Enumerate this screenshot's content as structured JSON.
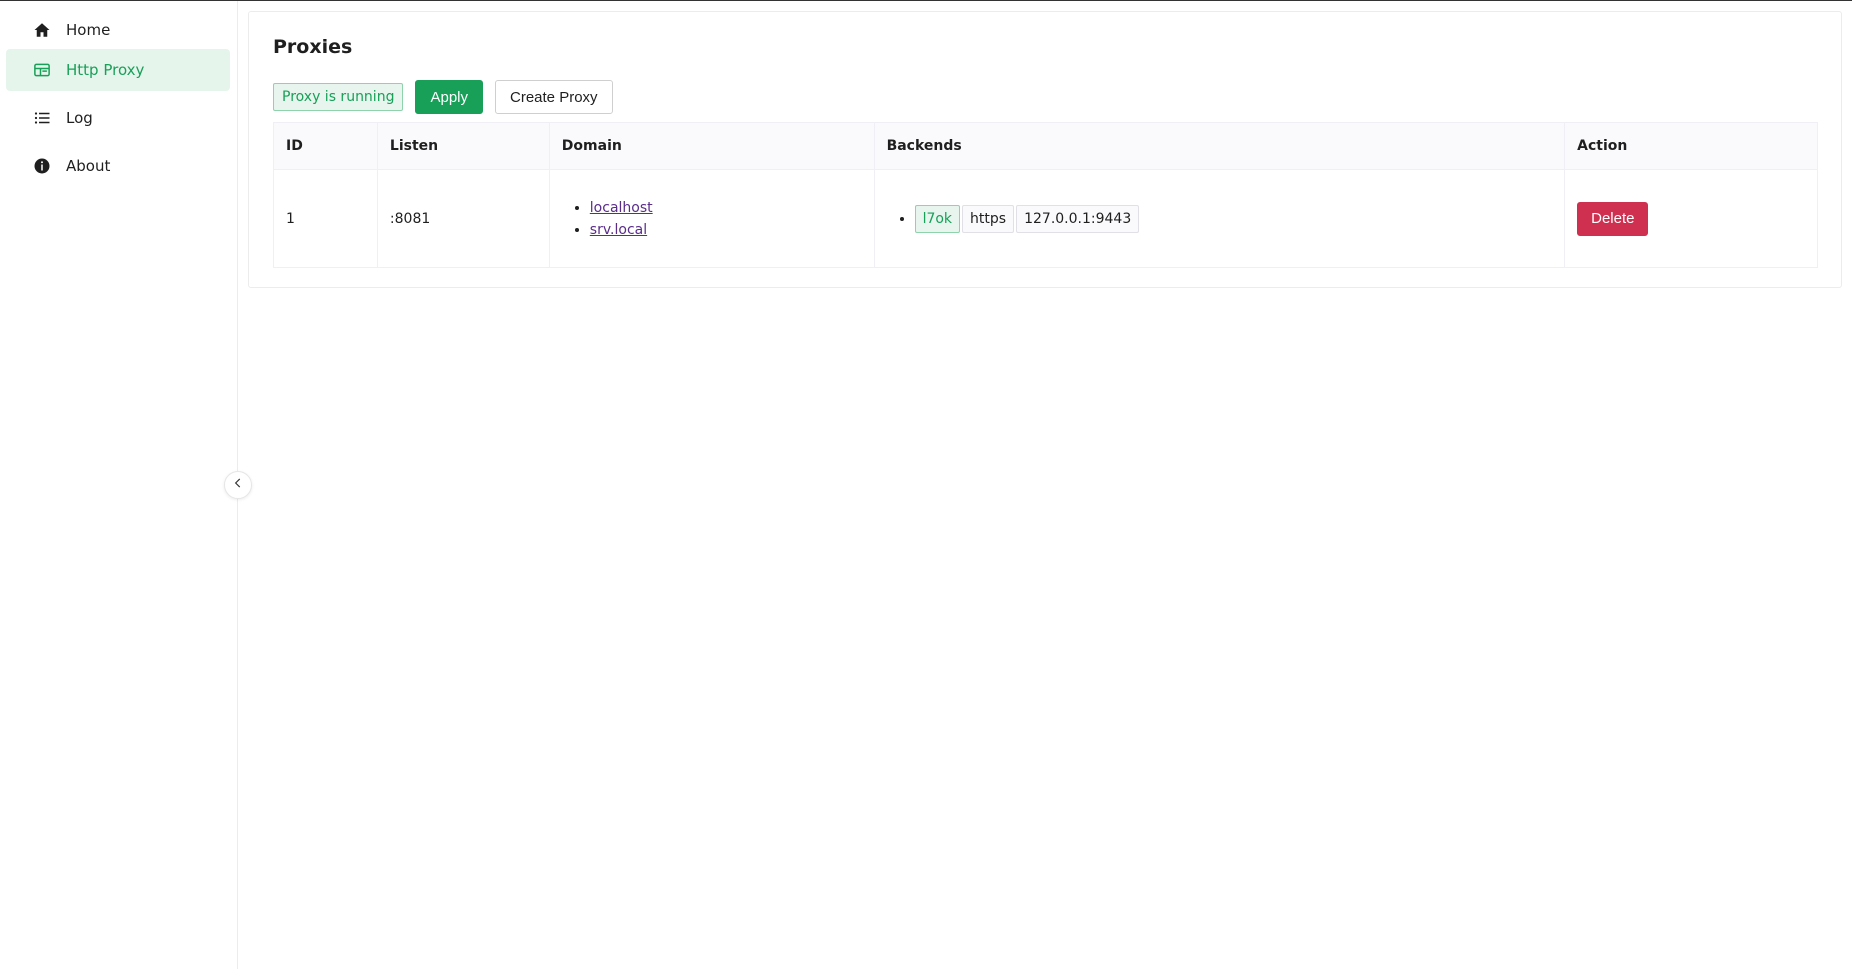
{
  "sidebar": {
    "items": [
      {
        "label": "Home",
        "icon": "home-icon",
        "active": false
      },
      {
        "label": "Http Proxy",
        "icon": "proxy-icon",
        "active": true
      },
      {
        "label": "Log",
        "icon": "list-icon",
        "active": false
      },
      {
        "label": "About",
        "icon": "info-icon",
        "active": false
      }
    ]
  },
  "colors": {
    "accent": "#18a058",
    "danger": "#d03050",
    "active_bg": "#e6f5ec"
  },
  "page": {
    "title": "Proxies",
    "status": "Proxy is running",
    "apply_label": "Apply",
    "create_label": "Create Proxy"
  },
  "table": {
    "headers": [
      "ID",
      "Listen",
      "Domain",
      "Backends",
      "Action"
    ],
    "rows": [
      {
        "id": "1",
        "listen": ":8081",
        "domains": [
          "localhost",
          "srv.local"
        ],
        "backends": [
          {
            "name": "l7ok",
            "scheme": "https",
            "address": "127.0.0.1:9443"
          }
        ],
        "action_label": "Delete"
      }
    ]
  }
}
